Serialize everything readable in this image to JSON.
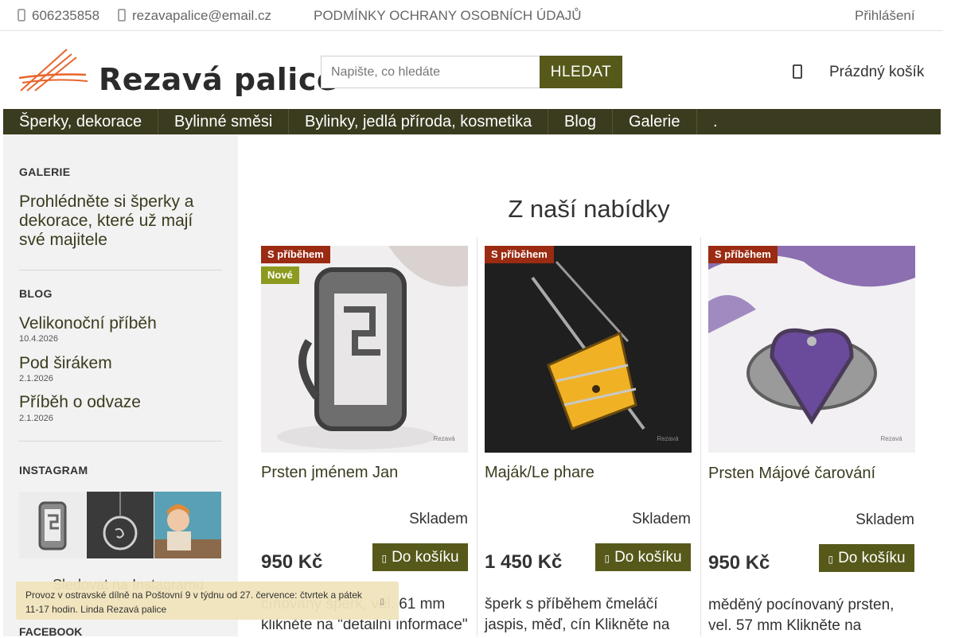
{
  "topbar": {
    "phone": "606235858",
    "email": "rezavapalice@email.cz",
    "privacy_link": "PODMÍNKY OCHRANY OSOBNÍCH ÚDAJŮ",
    "login": "Přihlášení"
  },
  "header": {
    "logo_text": "Rezavá palice",
    "search_placeholder": "Napište, co hledáte",
    "search_button": "HLEDAT",
    "cart_label": "Prázdný košík"
  },
  "nav": {
    "items": [
      "Šperky, dekorace",
      "Bylinné směsi",
      "Bylinky, jedlá příroda, kosmetika",
      "Blog",
      "Galerie",
      "."
    ]
  },
  "sidebar": {
    "gallery_title": "GALERIE",
    "gallery_link": "Prohlédněte si šperky a dekorace, které už mají své majitele",
    "blog_title": "BLOG",
    "posts": [
      {
        "title": "Velikonoční příběh",
        "date": "10.4.2026"
      },
      {
        "title": "Pod širákem",
        "date": "2.1.2026"
      },
      {
        "title": "Příběh o odvaze",
        "date": "2.1.2026"
      }
    ],
    "instagram_title": "INSTAGRAM",
    "instagram_follow": "Sledovat na Instagramu",
    "facebook_title": "FACEBOOK"
  },
  "main": {
    "title": "Z naší nabídky",
    "products": [
      {
        "name": "Prsten jménem Jan",
        "badges": [
          "S příběhem",
          "Nové"
        ],
        "stock": "Skladem",
        "price": "950 Kč",
        "buy": "Do košíku",
        "desc": "cínovaný šperk, vel. 61 mm klikněte na \"detailní informace\""
      },
      {
        "name": "Maják/Le phare",
        "badges": [
          "S příběhem"
        ],
        "stock": "Skladem",
        "price": "1 450 Kč",
        "buy": "Do košíku",
        "desc": "šperk s příběhem čmeláčí jaspis, měď, cín Klikněte na"
      },
      {
        "name": "Prsten Májové čarování",
        "badges": [
          "S příběhem"
        ],
        "stock": "Skladem",
        "price": "950 Kč",
        "buy": "Do košíku",
        "desc": "měděný pocínovaný prsten, vel. 57 mm Klikněte na"
      }
    ]
  },
  "notice": {
    "text": "Provoz v ostravské dílně na Poštovní 9 v týdnu od 27. července: čtvrtek a pátek 11-17 hodin. Linda Rezavá palice"
  },
  "colors": {
    "accent": "#56591a",
    "nav_bg": "#3b3b1f",
    "badge_story": "#9b2b12",
    "badge_new": "#8c9b1f",
    "logo_orange": "#e8642c"
  }
}
